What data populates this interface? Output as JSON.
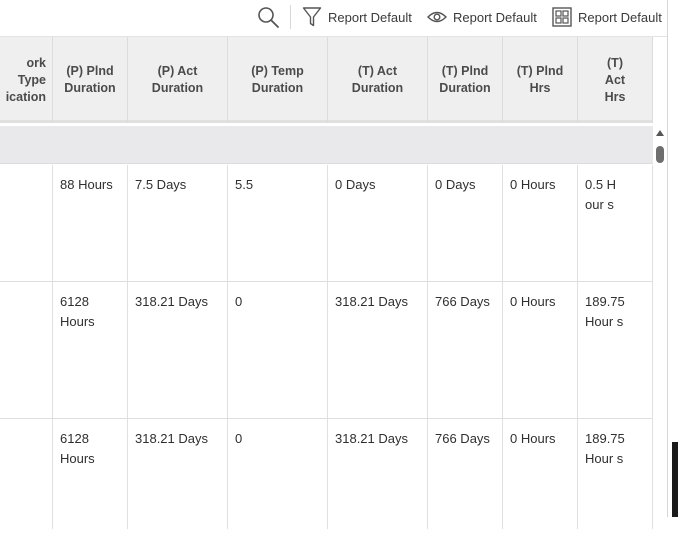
{
  "toolbar": {
    "search_icon": "search-icon",
    "filter_label": "Report Default",
    "view_label": "Report Default",
    "columns_label": "Report Default"
  },
  "table": {
    "headers": [
      "ork Type\nication",
      "(P) Plnd\nDuration",
      "(P) Act Duration",
      "(P) Temp\nDuration",
      "(T) Act\nDuration",
      "(T) Plnd\nDuration",
      "(T) Plnd\nHrs",
      "(T)\nAct\nHrs"
    ],
    "rows": [
      [
        "",
        "88 Hours",
        "7.5 Days",
        "5.5",
        "0 Days",
        "0 Days",
        "0 Hours",
        "0.5 Hour s"
      ],
      [
        "",
        "6128 Hours",
        "318.21 Days",
        "0",
        "318.21 Days",
        "766 Days",
        "0 Hours",
        "189.75 Hour s"
      ],
      [
        "",
        "6128 Hours",
        "318.21 Days",
        "0",
        "318.21 Days",
        "766 Days",
        "0 Hours",
        "189.75 Hour s"
      ]
    ]
  }
}
